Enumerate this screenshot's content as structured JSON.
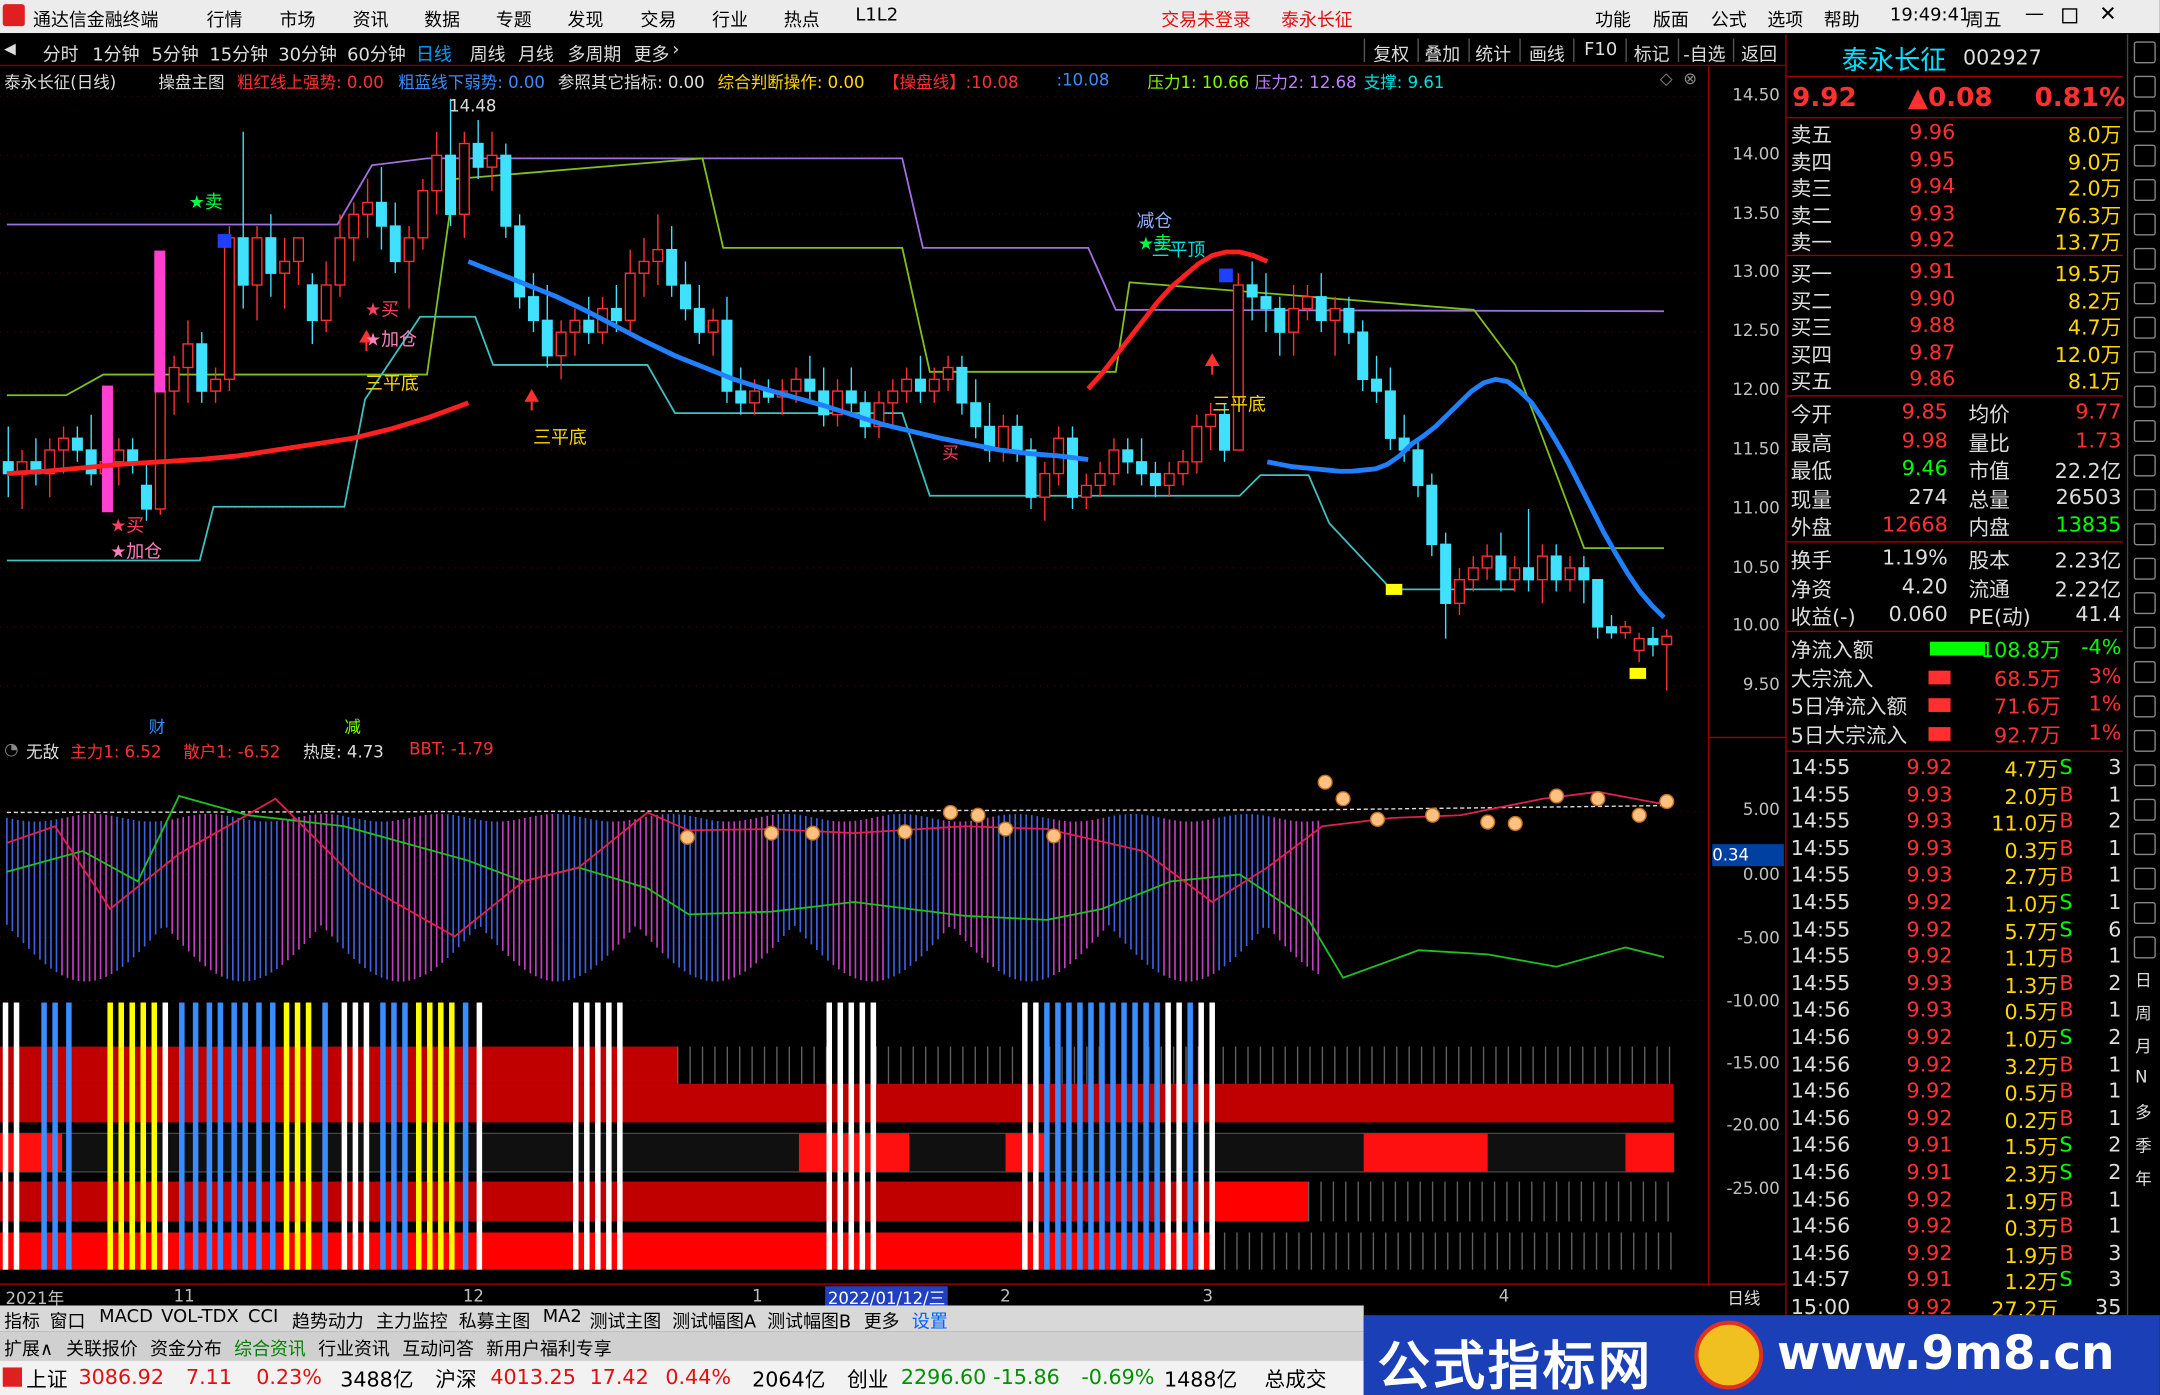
{
  "menu": {
    "app": "通达信金融终端",
    "items": [
      "行情",
      "市场",
      "资讯",
      "数据",
      "专题",
      "发现",
      "交易",
      "行业",
      "热点",
      "L1L2"
    ],
    "login": "交易未登录",
    "stock": "泰永长征",
    "right": [
      "功能",
      "版面",
      "公式",
      "选项",
      "帮助"
    ],
    "time": "19:49:41",
    "day": "周五"
  },
  "toolbar": {
    "left": [
      "分时",
      "1分钟",
      "5分钟",
      "15分钟",
      "30分钟",
      "60分钟",
      "日线",
      "周线",
      "月线",
      "多周期",
      "更多"
    ],
    "right": [
      "复权",
      "叠加",
      "统计",
      "画线",
      "F10",
      "标记",
      "-自选",
      "返回"
    ]
  },
  "info": {
    "title": "泰永长征(日线)",
    "formula": "操盘主图",
    "a": "粗红线上强势: 0.00",
    "b": "粗蓝线下弱势: 0.00",
    "c": "参照其它指标: 0.00",
    "d": "综合判断操作: 0.00",
    "e": "【操盘线】:10.08",
    "f": ":10.08",
    "g": "压力1: 10.66",
    "h": "压力2: 12.68",
    "i": "支撑: 9.61"
  },
  "price_axis": [
    "14.50",
    "14.00",
    "13.50",
    "13.00",
    "12.50",
    "12.00",
    "11.50",
    "11.00",
    "10.50",
    "10.00",
    "9.50"
  ],
  "ind_axis": [
    "5.00",
    "0.00",
    "-5.00",
    "-10.00",
    "-15.00",
    "-20.00",
    "-25.00"
  ],
  "ind_current": "0.34",
  "labels": {
    "max": "14.48",
    "sell": "★卖",
    "buy1": "★买",
    "add1": "★加仓",
    "buy2": "★买",
    "add2": "★加仓",
    "sanping1": "三平底",
    "sanping2": "三平底",
    "sanping3": "三平底",
    "jiancang": "减仓",
    "sell2": "★卖",
    "sanpingding": "三平顶",
    "buy3": "买",
    "cai": "财",
    "jian": "减"
  },
  "indbar": {
    "name": "无敌",
    "a": "主力1: 6.52",
    "b": "散户1: -6.52",
    "c": "热度: 4.73",
    "d": "BBT: -1.79"
  },
  "dates": [
    "2021年",
    "11",
    "12",
    "1",
    "2022/01/12/三",
    "2",
    "3",
    "4",
    "日线"
  ],
  "quote": {
    "name": "泰永长征",
    "code": "002927",
    "price": "9.92",
    "change": "▲0.08",
    "pct": "0.81%",
    "asks": [
      {
        "l": "卖五",
        "p": "9.96",
        "v": "8.0万"
      },
      {
        "l": "卖四",
        "p": "9.95",
        "v": "9.0万"
      },
      {
        "l": "卖三",
        "p": "9.94",
        "v": "2.0万"
      },
      {
        "l": "卖二",
        "p": "9.93",
        "v": "76.3万"
      },
      {
        "l": "卖一",
        "p": "9.92",
        "v": "13.7万"
      }
    ],
    "bids": [
      {
        "l": "买一",
        "p": "9.91",
        "v": "19.5万"
      },
      {
        "l": "买二",
        "p": "9.90",
        "v": "8.2万"
      },
      {
        "l": "买三",
        "p": "9.88",
        "v": "4.7万"
      },
      {
        "l": "买四",
        "p": "9.87",
        "v": "12.0万"
      },
      {
        "l": "买五",
        "p": "9.86",
        "v": "8.1万"
      }
    ],
    "stats": [
      [
        "今开",
        "9.85",
        "均价",
        "9.77"
      ],
      [
        "最高",
        "9.98",
        "量比",
        "1.73"
      ],
      [
        "最低",
        "9.46",
        "市值",
        "22.2亿"
      ],
      [
        "现量",
        "274",
        "总量",
        "26503"
      ],
      [
        "外盘",
        "12668",
        "内盘",
        "13835"
      ]
    ],
    "stats2": [
      [
        "换手",
        "1.19%",
        "股本",
        "2.23亿"
      ],
      [
        "净资",
        "4.20",
        "流通",
        "2.22亿"
      ],
      [
        "收益(-)",
        "0.060",
        "PE(动)",
        "41.4"
      ]
    ],
    "flows": [
      [
        "净流入额",
        "-108.8万",
        "-4%"
      ],
      [
        "大宗流入",
        "68.5万",
        "3%"
      ],
      [
        "5日净流入额",
        "71.6万",
        "1%"
      ],
      [
        "5日大宗流入",
        "92.7万",
        "1%"
      ]
    ],
    "ticks": [
      [
        "14:55",
        "9.92",
        "4.7万",
        "S",
        "3"
      ],
      [
        "14:55",
        "9.93",
        "2.0万",
        "B",
        "1"
      ],
      [
        "14:55",
        "9.93",
        "11.0万",
        "B",
        "2"
      ],
      [
        "14:55",
        "9.93",
        "0.3万",
        "B",
        "1"
      ],
      [
        "14:55",
        "9.93",
        "2.7万",
        "B",
        "1"
      ],
      [
        "14:55",
        "9.92",
        "1.0万",
        "S",
        "1"
      ],
      [
        "14:55",
        "9.92",
        "5.7万",
        "S",
        "6"
      ],
      [
        "14:55",
        "9.92",
        "1.1万",
        "B",
        "1"
      ],
      [
        "14:55",
        "9.93",
        "1.3万",
        "B",
        "2"
      ],
      [
        "14:56",
        "9.93",
        "0.5万",
        "B",
        "1"
      ],
      [
        "14:56",
        "9.92",
        "1.0万",
        "S",
        "2"
      ],
      [
        "14:56",
        "9.92",
        "3.2万",
        "B",
        "1"
      ],
      [
        "14:56",
        "9.92",
        "0.5万",
        "B",
        "1"
      ],
      [
        "14:56",
        "9.92",
        "0.2万",
        "B",
        "1"
      ],
      [
        "14:56",
        "9.91",
        "1.5万",
        "S",
        "2"
      ],
      [
        "14:56",
        "9.91",
        "2.3万",
        "S",
        "2"
      ],
      [
        "14:56",
        "9.92",
        "1.9万",
        "B",
        "1"
      ],
      [
        "14:56",
        "9.92",
        "0.3万",
        "B",
        "1"
      ],
      [
        "14:56",
        "9.92",
        "1.9万",
        "B",
        "3"
      ],
      [
        "14:57",
        "9.91",
        "1.2万",
        "S",
        "3"
      ],
      [
        "15:00",
        "9.92",
        "27.2万",
        "",
        "35"
      ]
    ]
  },
  "sidebar": [
    "日",
    "周",
    "月",
    "N",
    "多",
    "季",
    "年"
  ],
  "tabs1": [
    "指标",
    "窗口",
    "MACD",
    "VOL-TDX",
    "CCI",
    "趋势动力",
    "主力监控",
    "私募主图",
    "MA2",
    "测试主图",
    "测试幅图A",
    "测试幅图B",
    "更多",
    "设置"
  ],
  "tabs2": [
    "扩展∧",
    "关联报价",
    "资金分布",
    "综合资讯",
    "行业资讯",
    "互动问答",
    "新用户福利专享"
  ],
  "status": {
    "sh": "上证",
    "sh_v": "3086.92",
    "sh_c": "7.11",
    "sh_p": "0.23%",
    "sh_a": "3488亿",
    "sz": "沪深",
    "sz_v": "4013.25",
    "sz_c": "17.42",
    "sz_p": "0.44%",
    "sz_a": "2064亿",
    "cy": "创业",
    "cy_v": "2296.60",
    "cy_c": "-15.86",
    "cy_p": "-0.69%",
    "cy_a": "1488亿",
    "total": "总成交"
  },
  "watermark": {
    "t1": "公式指标网",
    "t2": "www.9m8.cn"
  },
  "chart_data": {
    "type": "candlestick",
    "ylim": [
      9.3,
      14.7
    ],
    "high_mark": 14.48,
    "ohlc": [
      [
        11.4,
        11.7,
        11.1,
        11.3
      ],
      [
        11.3,
        11.5,
        11.0,
        11.4
      ],
      [
        11.4,
        11.6,
        11.2,
        11.3
      ],
      [
        11.3,
        11.6,
        11.1,
        11.5
      ],
      [
        11.5,
        11.7,
        11.3,
        11.6
      ],
      [
        11.6,
        11.7,
        11.4,
        11.5
      ],
      [
        11.5,
        11.8,
        11.2,
        11.3
      ],
      [
        11.3,
        11.5,
        11.1,
        11.4
      ],
      [
        11.4,
        11.6,
        11.2,
        11.5
      ],
      [
        11.5,
        11.6,
        11.3,
        11.4
      ],
      [
        11.2,
        11.4,
        10.9,
        11.0
      ],
      [
        11.0,
        12.1,
        10.95,
        12.0
      ],
      [
        12.0,
        12.3,
        11.8,
        12.2
      ],
      [
        12.2,
        12.6,
        11.9,
        12.4
      ],
      [
        12.4,
        12.5,
        11.9,
        12.0
      ],
      [
        12.0,
        12.2,
        11.9,
        12.1
      ],
      [
        12.1,
        13.4,
        12.0,
        13.3
      ],
      [
        13.3,
        14.2,
        12.7,
        12.9
      ],
      [
        12.9,
        13.4,
        12.6,
        13.3
      ],
      [
        13.3,
        13.5,
        12.8,
        13.0
      ],
      [
        13.0,
        13.3,
        12.7,
        13.1
      ],
      [
        13.1,
        13.3,
        12.9,
        13.3
      ],
      [
        12.9,
        13.0,
        12.4,
        12.6
      ],
      [
        12.6,
        13.1,
        12.5,
        12.9
      ],
      [
        12.9,
        13.5,
        12.8,
        13.3
      ],
      [
        13.3,
        13.6,
        13.1,
        13.5
      ],
      [
        13.5,
        13.8,
        13.3,
        13.6
      ],
      [
        13.6,
        13.9,
        13.2,
        13.4
      ],
      [
        13.4,
        13.6,
        13.0,
        13.1
      ],
      [
        13.1,
        13.4,
        12.7,
        13.3
      ],
      [
        13.3,
        13.8,
        13.2,
        13.7
      ],
      [
        13.7,
        14.2,
        13.5,
        14.0
      ],
      [
        14.0,
        14.48,
        13.4,
        13.5
      ],
      [
        13.5,
        14.2,
        13.3,
        14.1
      ],
      [
        14.1,
        14.3,
        13.8,
        13.9
      ],
      [
        13.9,
        14.2,
        13.7,
        14.0
      ],
      [
        14.0,
        14.1,
        13.3,
        13.4
      ],
      [
        13.4,
        13.5,
        12.7,
        12.8
      ],
      [
        12.8,
        13.0,
        12.5,
        12.6
      ],
      [
        12.6,
        12.9,
        12.2,
        12.3
      ],
      [
        12.3,
        12.6,
        12.1,
        12.5
      ],
      [
        12.5,
        12.7,
        12.3,
        12.6
      ],
      [
        12.6,
        12.8,
        12.4,
        12.5
      ],
      [
        12.5,
        12.8,
        12.4,
        12.7
      ],
      [
        12.7,
        12.9,
        12.5,
        12.6
      ],
      [
        12.6,
        13.2,
        12.5,
        13.0
      ],
      [
        13.0,
        13.3,
        12.8,
        13.1
      ],
      [
        13.1,
        13.5,
        12.9,
        13.2
      ],
      [
        13.2,
        13.4,
        12.8,
        12.9
      ],
      [
        12.9,
        13.1,
        12.6,
        12.7
      ],
      [
        12.7,
        12.9,
        12.4,
        12.5
      ],
      [
        12.5,
        12.7,
        12.3,
        12.6
      ],
      [
        12.6,
        12.8,
        11.9,
        12.0
      ],
      [
        12.0,
        12.2,
        11.8,
        11.9
      ],
      [
        11.9,
        12.1,
        11.8,
        12.0
      ],
      [
        12.0,
        12.1,
        11.9,
        11.95
      ],
      [
        11.95,
        12.1,
        11.8,
        12.0
      ],
      [
        12.0,
        12.2,
        11.9,
        12.1
      ],
      [
        12.1,
        12.3,
        11.9,
        12.0
      ],
      [
        12.0,
        12.2,
        11.7,
        11.8
      ],
      [
        11.8,
        12.1,
        11.7,
        12.0
      ],
      [
        12.0,
        12.2,
        11.8,
        11.9
      ],
      [
        11.9,
        12.0,
        11.6,
        11.7
      ],
      [
        11.7,
        12.0,
        11.6,
        11.9
      ],
      [
        11.9,
        12.1,
        11.7,
        12.0
      ],
      [
        12.0,
        12.2,
        11.9,
        12.1
      ],
      [
        12.1,
        12.3,
        11.9,
        12.0
      ],
      [
        12.0,
        12.2,
        11.9,
        12.1
      ],
      [
        12.1,
        12.3,
        12.0,
        12.2
      ],
      [
        12.2,
        12.3,
        11.8,
        11.9
      ],
      [
        11.9,
        12.1,
        11.6,
        11.7
      ],
      [
        11.7,
        11.9,
        11.4,
        11.5
      ],
      [
        11.5,
        11.8,
        11.4,
        11.7
      ],
      [
        11.7,
        11.8,
        11.4,
        11.5
      ],
      [
        11.5,
        11.6,
        11.0,
        11.1
      ],
      [
        11.1,
        11.4,
        10.9,
        11.3
      ],
      [
        11.3,
        11.7,
        11.2,
        11.6
      ],
      [
        11.6,
        11.7,
        11.0,
        11.1
      ],
      [
        11.1,
        11.3,
        11.0,
        11.2
      ],
      [
        11.2,
        11.4,
        11.1,
        11.3
      ],
      [
        11.3,
        11.6,
        11.2,
        11.5
      ],
      [
        11.5,
        11.6,
        11.3,
        11.4
      ],
      [
        11.4,
        11.6,
        11.2,
        11.3
      ],
      [
        11.3,
        11.4,
        11.1,
        11.2
      ],
      [
        11.2,
        11.4,
        11.1,
        11.3
      ],
      [
        11.3,
        11.5,
        11.2,
        11.4
      ],
      [
        11.4,
        11.8,
        11.3,
        11.7
      ],
      [
        11.7,
        11.9,
        11.5,
        11.8
      ],
      [
        11.8,
        11.9,
        11.4,
        11.5
      ],
      [
        11.5,
        13.0,
        11.5,
        12.9
      ],
      [
        12.9,
        13.1,
        12.6,
        12.8
      ],
      [
        12.8,
        13.0,
        12.5,
        12.7
      ],
      [
        12.7,
        12.8,
        12.3,
        12.5
      ],
      [
        12.5,
        12.9,
        12.3,
        12.7
      ],
      [
        12.7,
        12.9,
        12.6,
        12.8
      ],
      [
        12.8,
        13.0,
        12.5,
        12.6
      ],
      [
        12.6,
        12.8,
        12.3,
        12.7
      ],
      [
        12.7,
        12.8,
        12.4,
        12.5
      ],
      [
        12.5,
        12.6,
        12.0,
        12.1
      ],
      [
        12.1,
        12.3,
        11.9,
        12.0
      ],
      [
        12.0,
        12.2,
        11.5,
        11.6
      ],
      [
        11.6,
        11.8,
        11.4,
        11.5
      ],
      [
        11.5,
        11.6,
        11.1,
        11.2
      ],
      [
        11.2,
        11.3,
        10.6,
        10.7
      ],
      [
        10.7,
        10.8,
        9.9,
        10.2
      ],
      [
        10.2,
        10.5,
        10.1,
        10.4
      ],
      [
        10.4,
        10.6,
        10.3,
        10.5
      ],
      [
        10.5,
        10.7,
        10.4,
        10.6
      ],
      [
        10.6,
        10.8,
        10.3,
        10.4
      ],
      [
        10.4,
        10.6,
        10.3,
        10.5
      ],
      [
        10.5,
        11.0,
        10.3,
        10.4
      ],
      [
        10.4,
        10.7,
        10.2,
        10.6
      ],
      [
        10.6,
        10.7,
        10.3,
        10.4
      ],
      [
        10.4,
        10.6,
        10.3,
        10.5
      ],
      [
        10.5,
        10.6,
        10.2,
        10.4
      ],
      [
        10.4,
        10.3,
        9.9,
        10.0
      ],
      [
        10.0,
        10.1,
        9.9,
        9.95
      ],
      [
        9.95,
        10.05,
        9.9,
        10.0
      ],
      [
        9.8,
        9.95,
        9.7,
        9.9
      ],
      [
        9.9,
        10.0,
        9.75,
        9.85
      ],
      [
        9.85,
        9.98,
        9.46,
        9.92
      ]
    ],
    "ma_red": [
      11.3,
      11.32,
      11.35,
      11.38,
      11.4,
      11.42,
      11.45,
      11.5,
      11.55,
      11.6,
      11.68,
      11.78,
      11.9,
      12.02,
      12.15,
      12.3,
      12.45,
      12.6,
      12.75,
      12.88,
      12.98,
      13.08,
      13.15,
      13.18,
      13.18,
      13.15,
      13.1
    ],
    "ma_blue": [
      13.1,
      13.0,
      12.9,
      12.8,
      12.68,
      12.55,
      12.42,
      12.3,
      12.2,
      12.1,
      12.02,
      11.95,
      11.88,
      11.8,
      11.72,
      11.66,
      11.6,
      11.55,
      11.5,
      11.47,
      11.45,
      11.42,
      11.4,
      11.38,
      11.36,
      11.35,
      11.34,
      11.33,
      11.32,
      11.32,
      11.33,
      11.34,
      11.38,
      11.45,
      11.55,
      11.62,
      11.7,
      11.8,
      11.9,
      12.0,
      12.07,
      12.1,
      12.08,
      12.0,
      11.9,
      11.75,
      11.58,
      11.4,
      11.2,
      11.0,
      10.8,
      10.62,
      10.45,
      10.3,
      10.18,
      10.08
    ]
  }
}
